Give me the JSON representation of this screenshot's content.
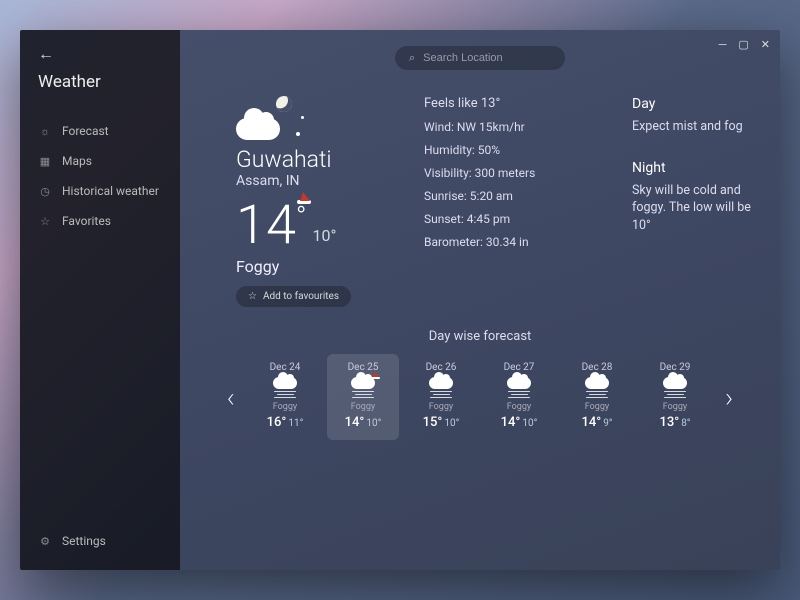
{
  "app": {
    "title": "Weather"
  },
  "nav": {
    "items": [
      {
        "label": "Forecast",
        "icon": "sun"
      },
      {
        "label": "Maps",
        "icon": "map"
      },
      {
        "label": "Historical weather",
        "icon": "history"
      },
      {
        "label": "Favorites",
        "icon": "star"
      }
    ],
    "settings": "Settings"
  },
  "search": {
    "placeholder": "Search Location"
  },
  "current": {
    "city": "Guwahati",
    "region": "Assam, IN",
    "temp_high": "14",
    "temp_low": "10°",
    "condition": "Foggy",
    "fav_label": "Add to favourites"
  },
  "details": {
    "feels": "Feels like 13°",
    "wind": "Wind: NW 15km/hr",
    "humidity": "Humidity: 50%",
    "visibility": "Visibility: 300 meters",
    "sunrise": "Sunrise: 5:20 am",
    "sunset": "Sunset: 4:45 pm",
    "barometer": "Barometer: 30.34 in"
  },
  "summary": {
    "day_title": "Day",
    "day_body": "Expect mist and fog",
    "night_title": "Night",
    "night_body": "Sky will be cold and foggy. The low will be 10°"
  },
  "forecast": {
    "title": "Day wise forecast",
    "days": [
      {
        "date": "Dec 24",
        "cond": "Foggy",
        "hi": "16°",
        "lo": "11°",
        "hat": false,
        "selected": false
      },
      {
        "date": "Dec 25",
        "cond": "Foggy",
        "hi": "14°",
        "lo": "10°",
        "hat": true,
        "selected": true
      },
      {
        "date": "Dec 26",
        "cond": "Foggy",
        "hi": "15°",
        "lo": "10°",
        "hat": false,
        "selected": false
      },
      {
        "date": "Dec 27",
        "cond": "Foggy",
        "hi": "14°",
        "lo": "10°",
        "hat": false,
        "selected": false
      },
      {
        "date": "Dec 28",
        "cond": "Foggy",
        "hi": "14°",
        "lo": "9°",
        "hat": false,
        "selected": false
      },
      {
        "date": "Dec 29",
        "cond": "Foggy",
        "hi": "13°",
        "lo": "8°",
        "hat": false,
        "selected": false
      }
    ]
  },
  "icons": {
    "sun": "☼",
    "map": "▦",
    "history": "◷",
    "star": "☆",
    "gear": "⚙",
    "search": "⌕",
    "back": "←"
  }
}
